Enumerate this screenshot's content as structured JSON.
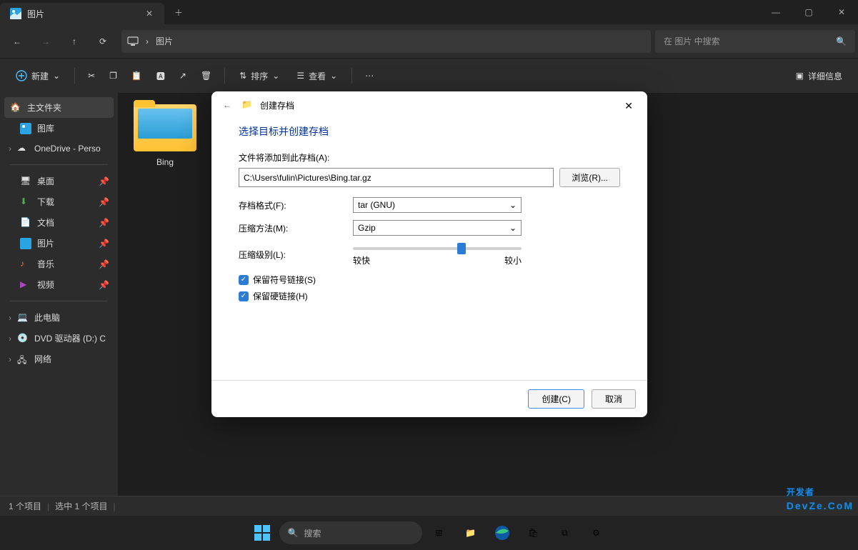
{
  "titlebar": {
    "tab_title": "图片"
  },
  "addressbar": {
    "segment": "图片",
    "search_placeholder": "在 图片 中搜索"
  },
  "toolbar": {
    "new_label": "新建",
    "sort_label": "排序",
    "view_label": "查看",
    "details_label": "详细信息"
  },
  "sidebar": {
    "home": "主文件夹",
    "gallery": "图库",
    "onedrive": "OneDrive - Perso",
    "desktop": "桌面",
    "downloads": "下载",
    "documents": "文档",
    "pictures": "图片",
    "music": "音乐",
    "videos": "视频",
    "this_pc": "此电脑",
    "dvd": "DVD 驱动器 (D:) C",
    "network": "网络"
  },
  "content": {
    "folder_name": "Bing"
  },
  "statusbar": {
    "items": "1 个项目",
    "selected": "选中 1 个项目"
  },
  "taskbar": {
    "search_placeholder": "搜索"
  },
  "dialog": {
    "title": "创建存档",
    "heading": "选择目标并创建存档",
    "add_label": "文件将添加到此存档(A):",
    "path_value": "C:\\Users\\fulin\\Pictures\\Bing.tar.gz",
    "browse": "浏览(R)...",
    "format_label": "存档格式(F):",
    "format_value": "tar (GNU)",
    "method_label": "压缩方法(M):",
    "method_value": "Gzip",
    "level_label": "压缩级别(L):",
    "level_fast": "较快",
    "level_small": "较小",
    "symlink_label": "保留符号链接(S)",
    "hardlink_label": "保留硬链接(H)",
    "create": "创建(C)",
    "cancel": "取消"
  },
  "watermark": {
    "main": "开发者",
    "sub": "DevZe.CoM"
  }
}
